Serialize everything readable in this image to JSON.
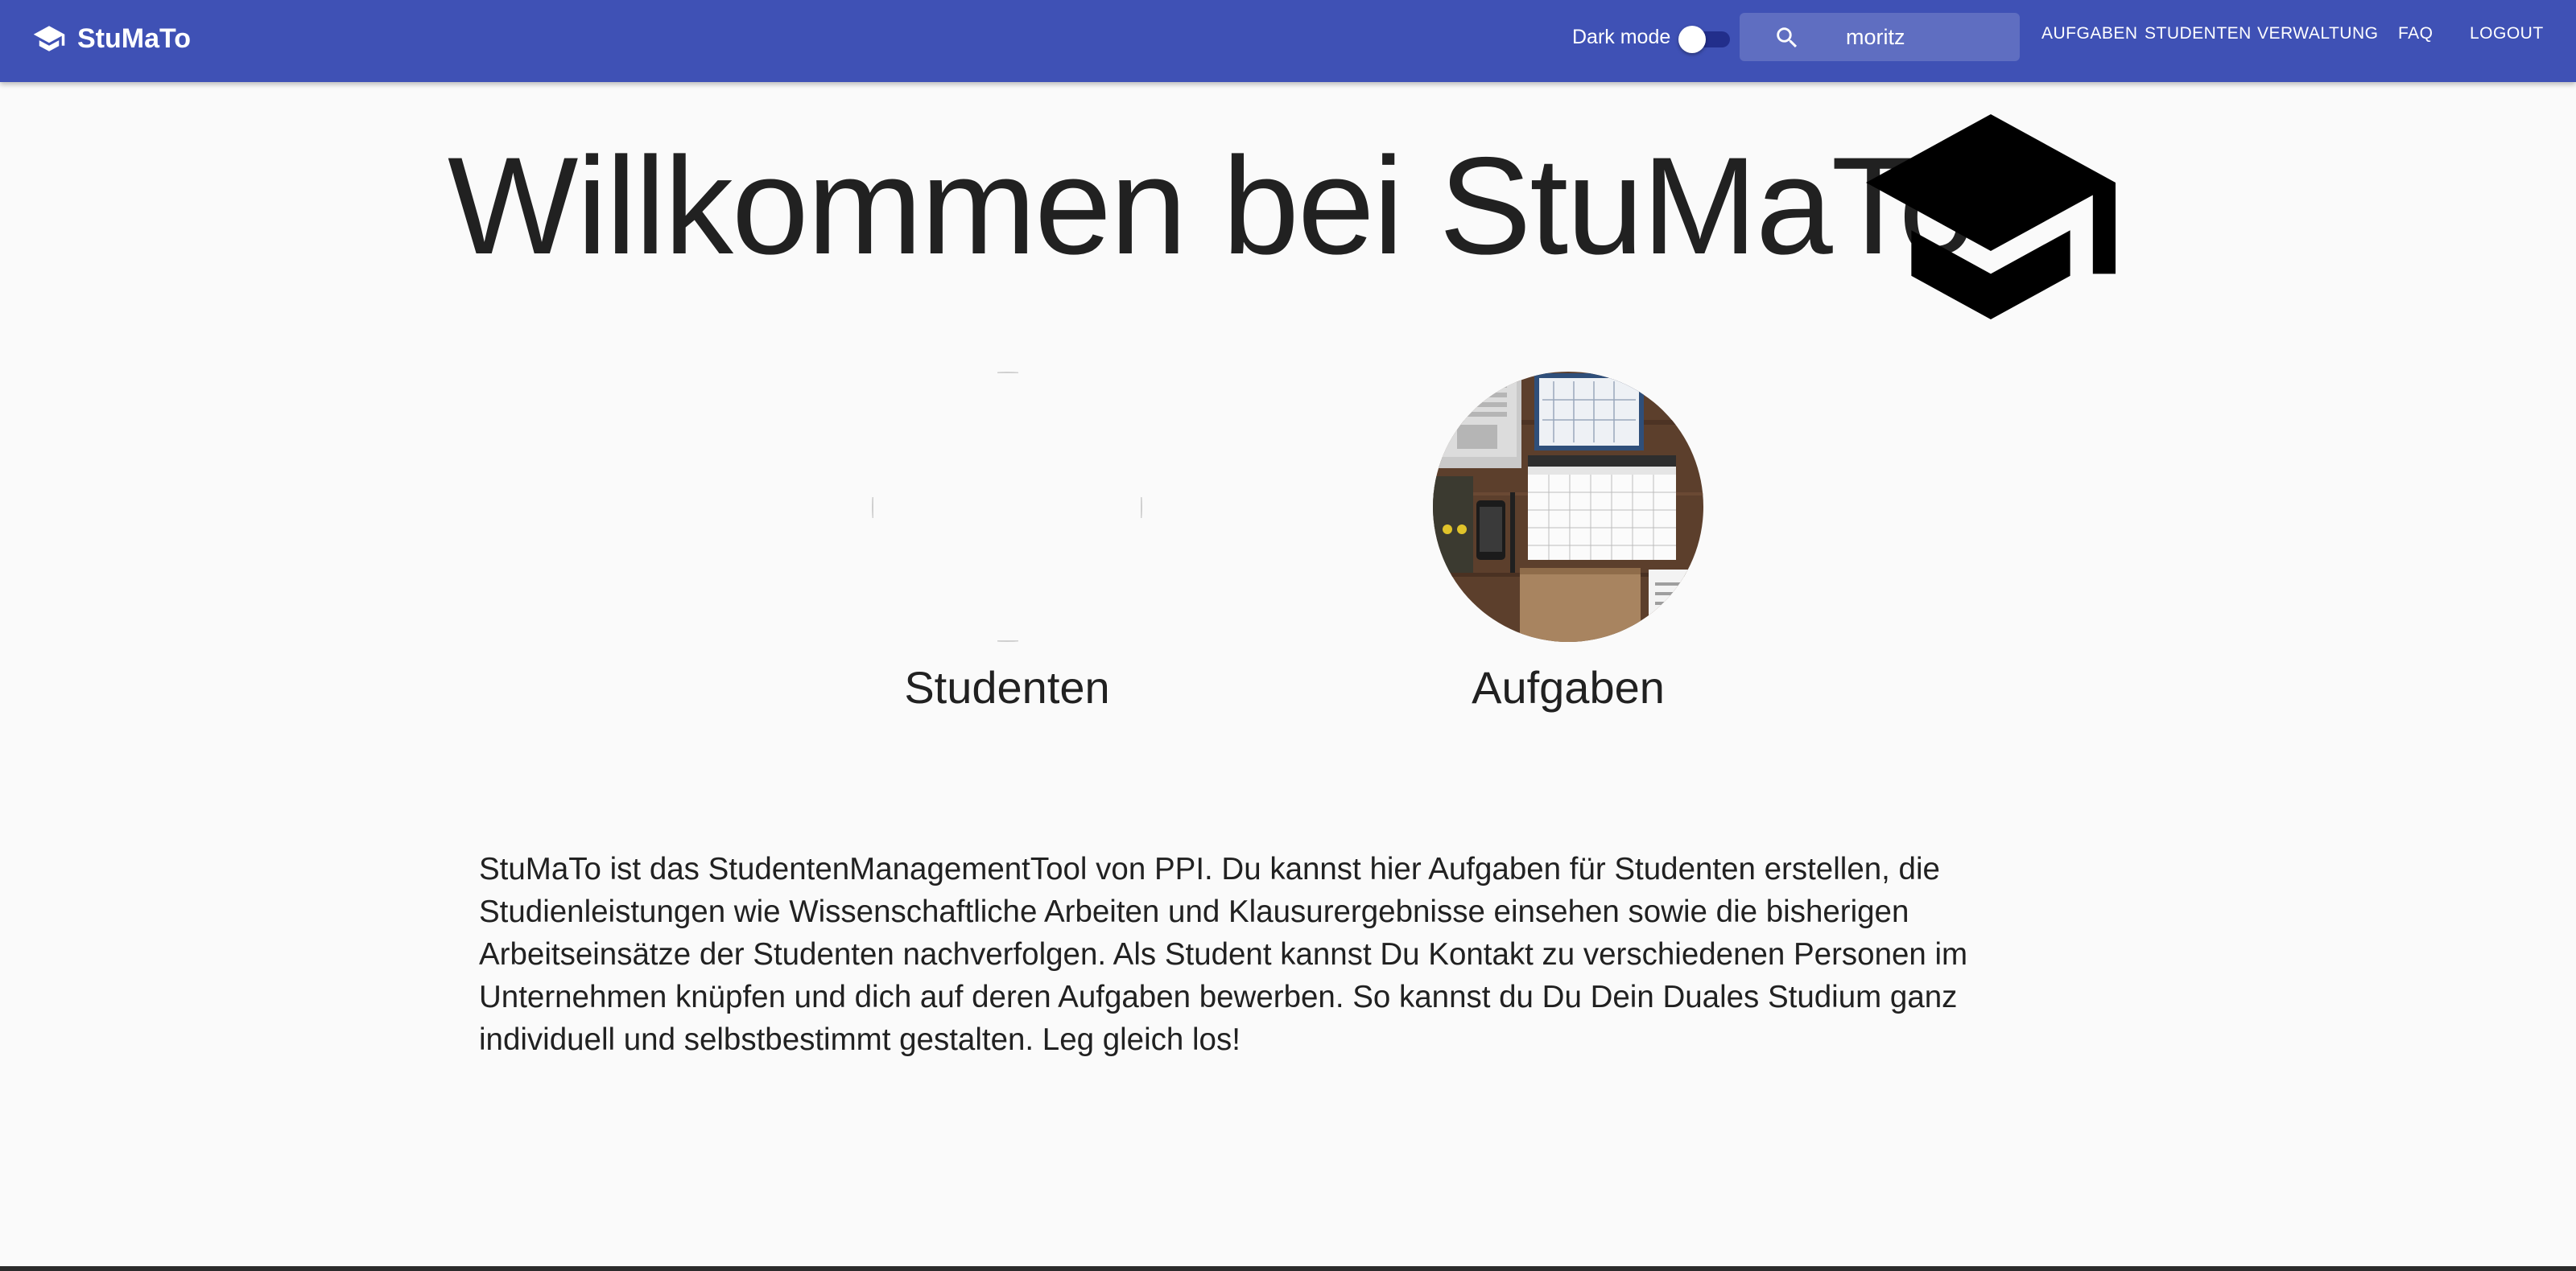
{
  "toolbar": {
    "brand_title": "StuMaTo",
    "brand_icon": "graduation-cap-icon",
    "dark_mode_label": "Dark mode",
    "dark_mode_enabled": false,
    "search_icon": "search-icon",
    "search_value": "moritz",
    "nav": {
      "aufgaben": "AUFGABEN",
      "studenten": "STUDENTEN",
      "verwaltung": "VERWALTUNG",
      "faq": "FAQ",
      "logout": "LOGOUT"
    },
    "color": "#3f51b5"
  },
  "hero": {
    "title": "Willkommen bei StuMaTo",
    "icon": "graduation-cap-icon"
  },
  "tiles": [
    {
      "label": "Studenten",
      "image": "blank"
    },
    {
      "label": "Aufgaben",
      "image": "desk-calendar-photo"
    }
  ],
  "description": "StuMaTo ist das StudentenManagementTool von PPI. Du kannst hier Aufgaben für Studenten erstellen, die Studienleistungen wie Wissenschaftliche Arbeiten und Klausurergebnisse einsehen sowie die bisherigen Arbeitseinsätze der Studenten nachverfolgen. Als Student kannst Du Kontakt zu verschiedenen Personen im Unternehmen knüpfen und dich auf deren Aufgaben bewerben. So kannst du Du Dein Duales Studium ganz individuell und selbstbestimmt gestalten. Leg gleich los!"
}
